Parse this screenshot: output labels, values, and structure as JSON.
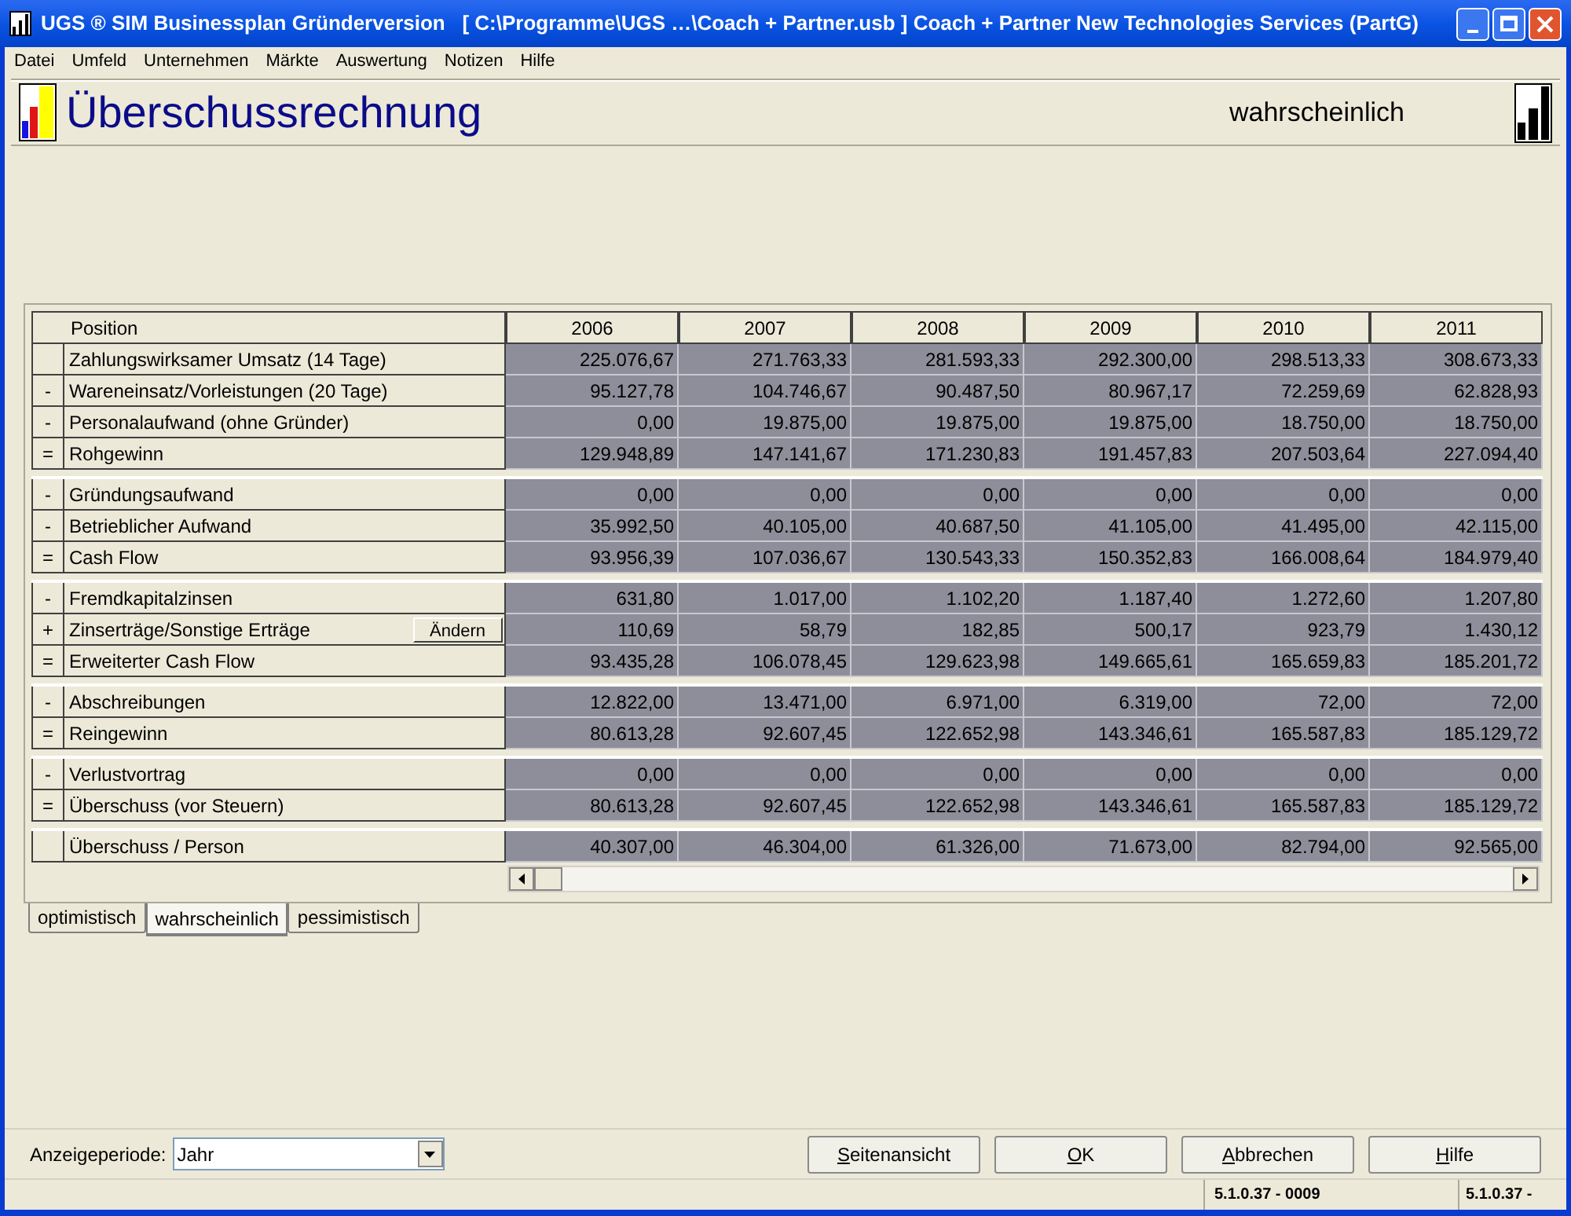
{
  "window": {
    "title": "UGS ® SIM Businessplan Gründerversion   [ C:\\Programme\\UGS …\\Coach + Partner.usb ] Coach + Partner New Technologies Services (PartG)"
  },
  "menu": [
    "Datei",
    "Umfeld",
    "Unternehmen",
    "Märkte",
    "Auswertung",
    "Notizen",
    "Hilfe"
  ],
  "header": {
    "title": "Überschussrechnung",
    "scenario": "wahrscheinlich"
  },
  "table": {
    "columns": [
      "Position",
      "2006",
      "2007",
      "2008",
      "2009",
      "2010",
      "2011"
    ],
    "groups": [
      {
        "rows": [
          {
            "label": "Zahlungswirksamer Umsatz (14 Tage)",
            "values": [
              "225.076,67",
              "271.763,33",
              "281.593,33",
              "292.300,00",
              "298.513,33",
              "308.673,33"
            ]
          },
          {
            "op": "-",
            "label": "Wareneinsatz/Vorleistungen (20 Tage)",
            "values": [
              "95.127,78",
              "104.746,67",
              "90.487,50",
              "80.967,17",
              "72.259,69",
              "62.828,93"
            ]
          },
          {
            "op": "-",
            "label": "Personalaufwand (ohne Gründer)",
            "values": [
              "0,00",
              "19.875,00",
              "19.875,00",
              "19.875,00",
              "18.750,00",
              "18.750,00"
            ]
          },
          {
            "op": "=",
            "label": "Rohgewinn",
            "values": [
              "129.948,89",
              "147.141,67",
              "171.230,83",
              "191.457,83",
              "207.503,64",
              "227.094,40"
            ]
          }
        ]
      },
      {
        "rows": [
          {
            "op": "-",
            "label": "Gründungsaufwand",
            "values": [
              "0,00",
              "0,00",
              "0,00",
              "0,00",
              "0,00",
              "0,00"
            ]
          },
          {
            "op": "-",
            "label": "Betrieblicher Aufwand",
            "values": [
              "35.992,50",
              "40.105,00",
              "40.687,50",
              "41.105,00",
              "41.495,00",
              "42.115,00"
            ]
          },
          {
            "op": "=",
            "label": "Cash Flow",
            "values": [
              "93.956,39",
              "107.036,67",
              "130.543,33",
              "150.352,83",
              "166.008,64",
              "184.979,40"
            ]
          }
        ]
      },
      {
        "rows": [
          {
            "op": "-",
            "label": "Fremdkapitalzinsen",
            "values": [
              "631,80",
              "1.017,00",
              "1.102,20",
              "1.187,40",
              "1.272,60",
              "1.207,80"
            ]
          },
          {
            "op": "+",
            "label": "Zinserträge/Sonstige Erträge",
            "action": "Ändern",
            "values": [
              "110,69",
              "58,79",
              "182,85",
              "500,17",
              "923,79",
              "1.430,12"
            ]
          },
          {
            "op": "=",
            "label": "Erweiterter Cash Flow",
            "values": [
              "93.435,28",
              "106.078,45",
              "129.623,98",
              "149.665,61",
              "165.659,83",
              "185.201,72"
            ]
          }
        ]
      },
      {
        "rows": [
          {
            "op": "-",
            "label": "Abschreibungen",
            "values": [
              "12.822,00",
              "13.471,00",
              "6.971,00",
              "6.319,00",
              "72,00",
              "72,00"
            ]
          },
          {
            "op": "=",
            "label": "Reingewinn",
            "values": [
              "80.613,28",
              "92.607,45",
              "122.652,98",
              "143.346,61",
              "165.587,83",
              "185.129,72"
            ]
          }
        ]
      },
      {
        "rows": [
          {
            "op": "-",
            "label": "Verlustvortrag",
            "values": [
              "0,00",
              "0,00",
              "0,00",
              "0,00",
              "0,00",
              "0,00"
            ]
          },
          {
            "op": "=",
            "label": "Überschuss (vor Steuern)",
            "values": [
              "80.613,28",
              "92.607,45",
              "122.652,98",
              "143.346,61",
              "165.587,83",
              "185.129,72"
            ]
          }
        ]
      },
      {
        "rows": [
          {
            "label": "Überschuss / Person",
            "values": [
              "40.307,00",
              "46.304,00",
              "61.326,00",
              "71.673,00",
              "82.794,00",
              "92.565,00"
            ]
          }
        ]
      }
    ]
  },
  "tabs": [
    {
      "label": "optimistisch",
      "selected": false
    },
    {
      "label": "wahrscheinlich",
      "selected": true
    },
    {
      "label": "pessimistisch",
      "selected": false
    }
  ],
  "period": {
    "label": "Anzeigeperiode:",
    "value": "Jahr"
  },
  "buttons": [
    {
      "mnemonic": "S",
      "rest": "eitenansicht"
    },
    {
      "mnemonic": "O",
      "rest": "K"
    },
    {
      "mnemonic": "A",
      "rest": "bbrechen"
    },
    {
      "mnemonic": "H",
      "rest": "ilfe"
    }
  ],
  "status_bar": [
    "5.1.0.37 - 0009",
    "5.1.0.37 -"
  ]
}
